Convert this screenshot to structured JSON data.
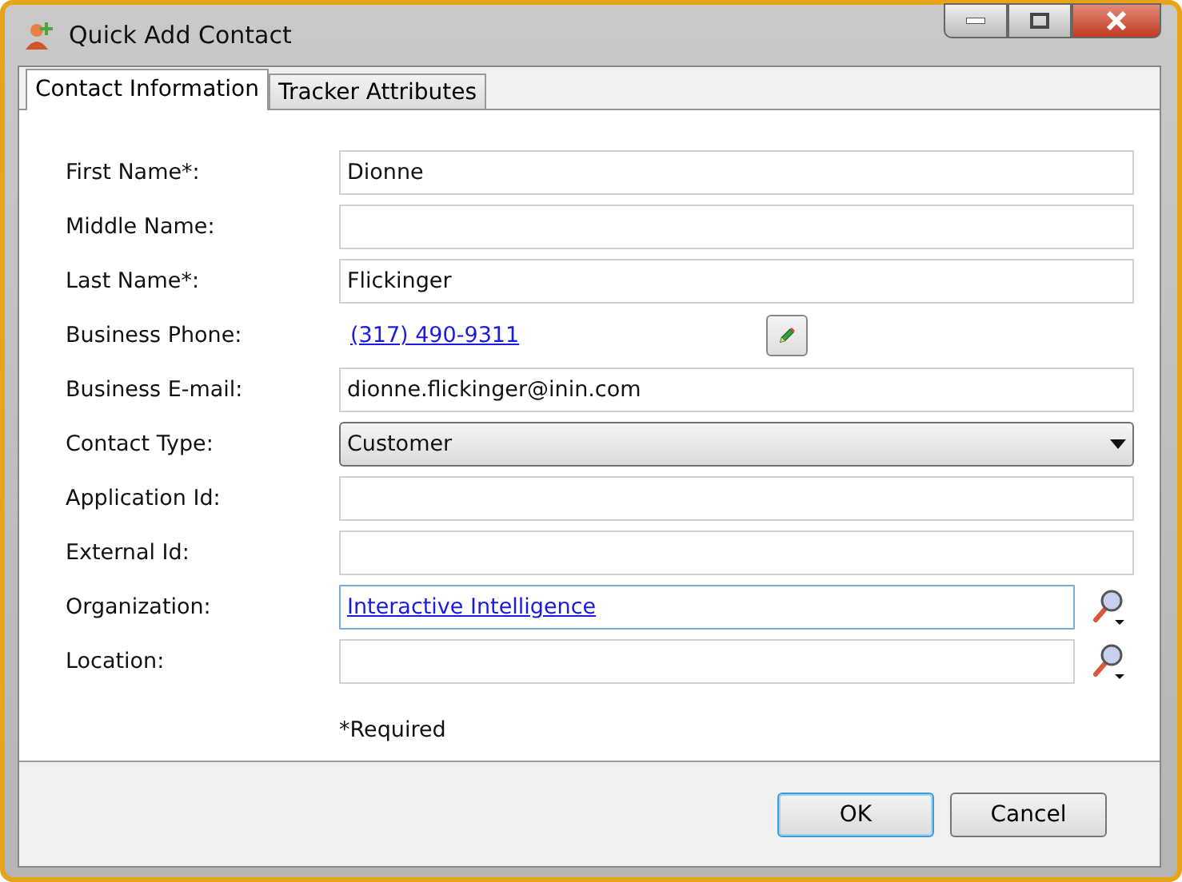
{
  "window": {
    "title": "Quick Add Contact"
  },
  "tabs": [
    {
      "label": "Contact Information",
      "selected": true
    },
    {
      "label": "Tracker Attributes",
      "selected": false
    }
  ],
  "fields": [
    {
      "kind": "text",
      "label": "First Name*:",
      "value": "Dionne"
    },
    {
      "kind": "text",
      "label": "Middle Name:"
    },
    {
      "kind": "text",
      "label": "Last Name*:",
      "value": "Flickinger"
    },
    {
      "kind": "phone",
      "label": "Business Phone:",
      "value": "(317) 490-9311"
    },
    {
      "kind": "text",
      "label": "Business E-mail:",
      "value": "dionne.flickinger@inin.com"
    },
    {
      "kind": "select",
      "label": "Contact Type:",
      "value": "Customer"
    },
    {
      "kind": "text",
      "label": "Application Id:"
    },
    {
      "kind": "text",
      "label": "External Id:"
    },
    {
      "kind": "lookup",
      "label": "Organization:",
      "value": "Interactive Intelligence",
      "link": true,
      "focused": true
    },
    {
      "kind": "lookup",
      "label": "Location:",
      "focused": false
    }
  ],
  "note": "*Required",
  "buttons": [
    {
      "label": "OK",
      "default": true
    },
    {
      "label": "Cancel",
      "default": false
    }
  ]
}
